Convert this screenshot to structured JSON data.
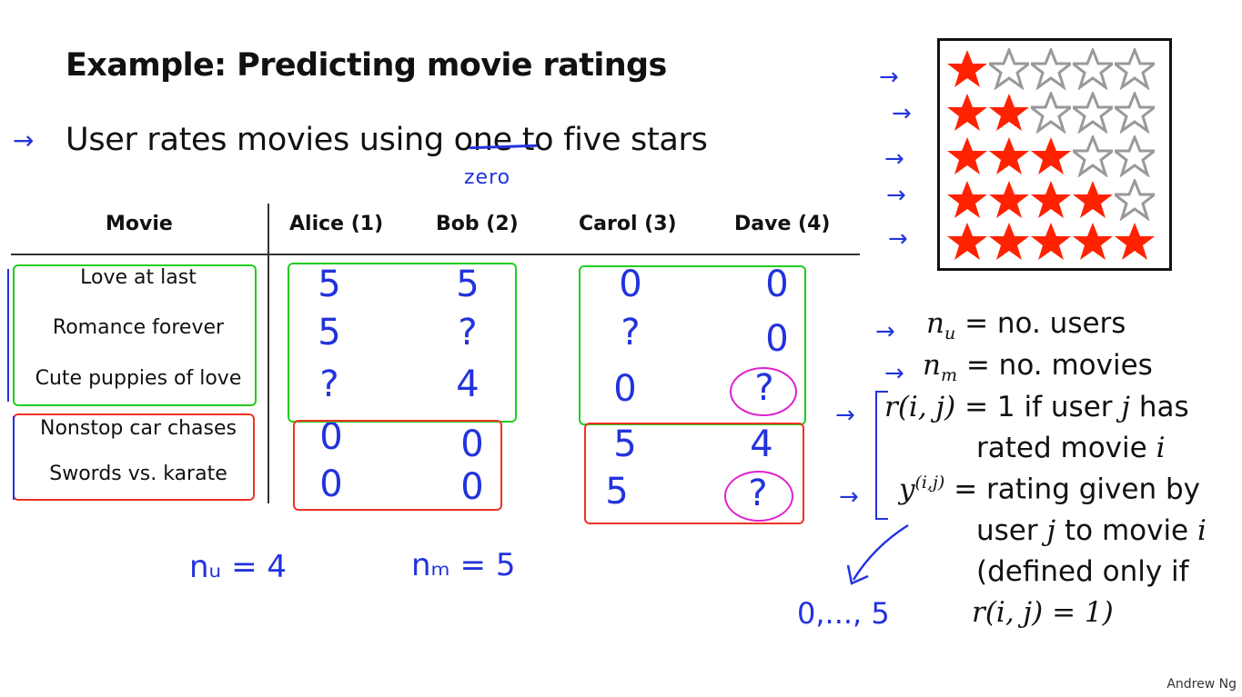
{
  "title": "Example: Predicting movie ratings",
  "bullet": "User rates movies using one to five stars",
  "bullet_parts": {
    "before": "User rates movies using ",
    "struck": "one",
    "after": " to five stars"
  },
  "annotation_zero": "zero",
  "table": {
    "headers": [
      "Movie",
      "Alice (1)",
      "Bob (2)",
      "Carol (3)",
      "Dave (4)"
    ],
    "rows": [
      {
        "movie": "Love at last",
        "ratings": [
          "5",
          "5",
          "0",
          "0"
        ]
      },
      {
        "movie": "Romance forever",
        "ratings": [
          "5",
          "?",
          "?",
          "0"
        ]
      },
      {
        "movie": "Cute puppies of love",
        "ratings": [
          "?",
          "4",
          "0",
          "?"
        ]
      },
      {
        "movie": "Nonstop car chases",
        "ratings": [
          "0",
          "0",
          "5",
          "4"
        ]
      },
      {
        "movie": "Swords vs. karate",
        "ratings": [
          "0",
          "0",
          "5",
          "?"
        ]
      }
    ]
  },
  "counts": {
    "nu": "nᵤ = 4",
    "nm": "nₘ = 5"
  },
  "star_scale": {
    "max": 5,
    "levels": [
      1,
      2,
      3,
      4,
      5
    ]
  },
  "definitions": {
    "nu_sym": "n",
    "nu_sub": "u",
    "nu_text": " = no. users",
    "nm_sym": "n",
    "nm_sub": "m",
    "nm_text": " = no. movies",
    "r_sym": "r(i, j)",
    "r_text_1": " = 1 if user ",
    "r_j": "j",
    "r_text_2": " has",
    "r_line2": "rated movie ",
    "r_i": "i",
    "y_sym": "y",
    "y_sup": "(i,j)",
    "y_text": " = rating given by",
    "y_line2": "user ",
    "y_j": "j",
    "y_line2b": " to movie ",
    "y_i": "i",
    "y_line3": "(defined only if",
    "y_line4": "r(i, j) = 1)"
  },
  "range_note": "0,..., 5",
  "credit": "Andrew Ng",
  "colors": {
    "ink": "#2233dd",
    "green": "#22cc22",
    "red": "#ee3322",
    "magenta": "#dd22cc",
    "star_red": "#ff2200",
    "star_gray": "#999999"
  }
}
